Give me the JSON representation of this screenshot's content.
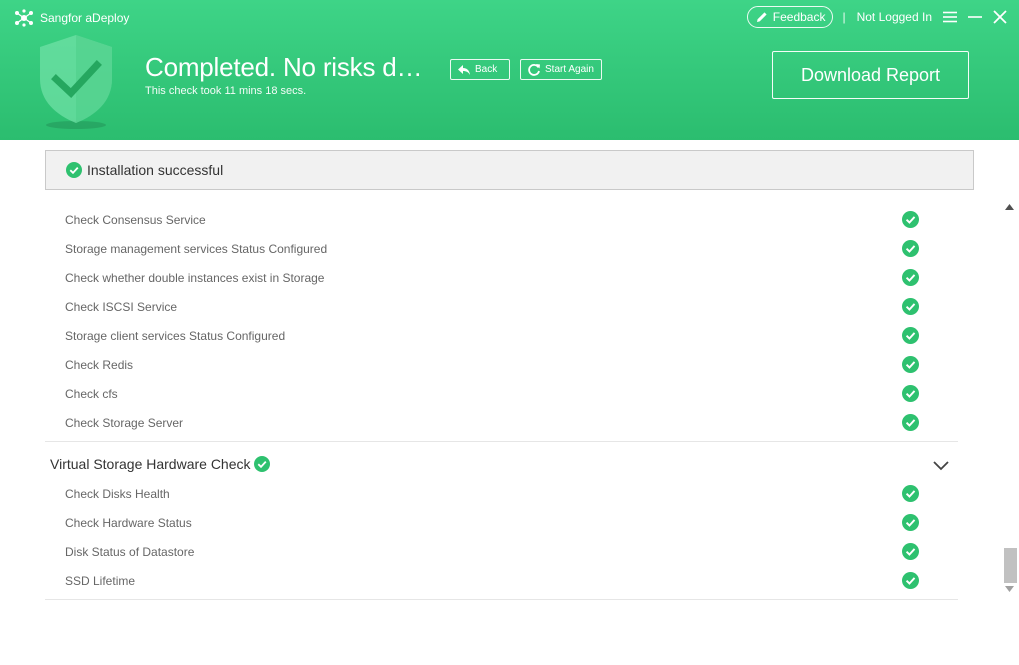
{
  "app": {
    "name": "Sangfor aDeploy"
  },
  "topbar": {
    "feedback_label": "Feedback",
    "separator": "|",
    "login_status": "Not Logged In"
  },
  "result": {
    "title": "Completed. No risks d…",
    "duration": "This check took 11 mins 18 secs.",
    "back_label": "Back",
    "start_again_label": "Start Again",
    "download_label": "Download Report"
  },
  "install_status": "Installation successful",
  "checks_group1": [
    "Check Consensus Service",
    "Storage management services Status Configured",
    "Check whether double instances exist in Storage",
    "Check ISCSI Service",
    "Storage client services Status Configured",
    "Check Redis",
    "Check cfs",
    "Check Storage Server"
  ],
  "section2": {
    "title": "Virtual Storage Hardware Check",
    "checks": [
      "Check Disks Health",
      "Check Hardware Status",
      "Disk Status of Datastore",
      "SSD Lifetime"
    ]
  },
  "colors": {
    "accent": "#2bbd6f",
    "check": "#2ec16f"
  }
}
